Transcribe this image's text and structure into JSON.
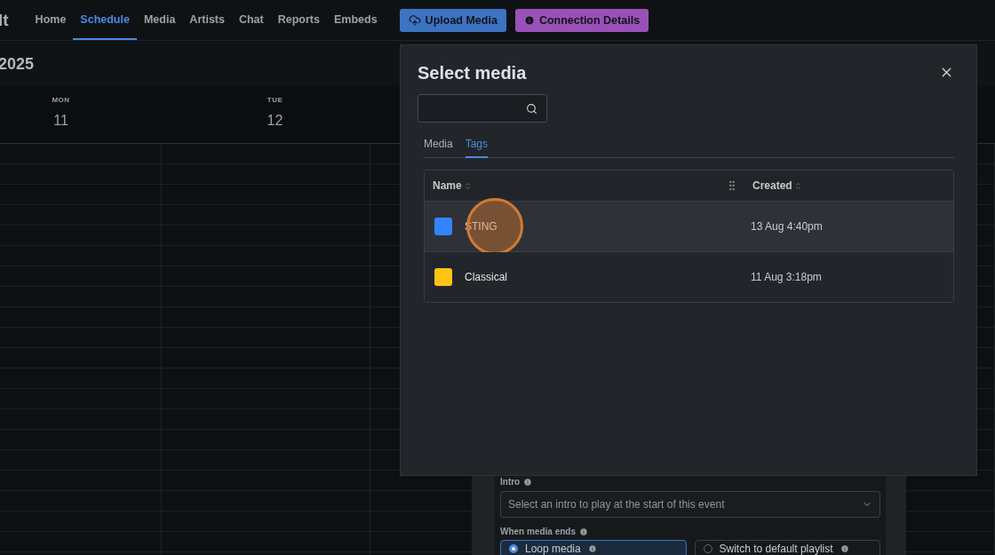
{
  "nav": {
    "logo_text": "lt",
    "items": [
      {
        "label": "Home",
        "selected": false
      },
      {
        "label": "Schedule",
        "selected": true
      },
      {
        "label": "Media",
        "selected": false
      },
      {
        "label": "Artists",
        "selected": false
      },
      {
        "label": "Chat",
        "selected": false
      },
      {
        "label": "Reports",
        "selected": false
      },
      {
        "label": "Embeds",
        "selected": false
      }
    ],
    "buttons": [
      {
        "label": "Upload Media",
        "kind": "upload"
      },
      {
        "label": "Connection Details",
        "kind": "info"
      }
    ]
  },
  "calendar": {
    "title": "2025",
    "days": [
      {
        "weekday": "MON",
        "date": "11"
      },
      {
        "weekday": "TUE",
        "date": "12"
      }
    ]
  },
  "event_panel": {
    "intro_label": "Intro",
    "intro_select": {
      "placeholder": "Select an intro to play at the start of this event"
    },
    "media_end_label": "When media ends",
    "media_end_options": [
      {
        "label": "Loop media",
        "selected": true
      },
      {
        "label": "Switch to default playlist",
        "selected": false
      }
    ]
  },
  "modal": {
    "title": "Select media",
    "tabs": [
      {
        "label": "Media",
        "selected": false
      },
      {
        "label": "Tags",
        "selected": true
      }
    ],
    "table": {
      "columns": [
        {
          "label": "Name"
        },
        {
          "label": "Created"
        }
      ],
      "rows": [
        {
          "name": "STING",
          "color": "#3384ff",
          "created": "13 Aug 4:40pm",
          "selected": true,
          "clicked": true
        },
        {
          "name": "Classical",
          "color": "#ffc414",
          "created": "11 Aug 3:18pm",
          "selected": false,
          "clicked": false
        }
      ]
    }
  }
}
